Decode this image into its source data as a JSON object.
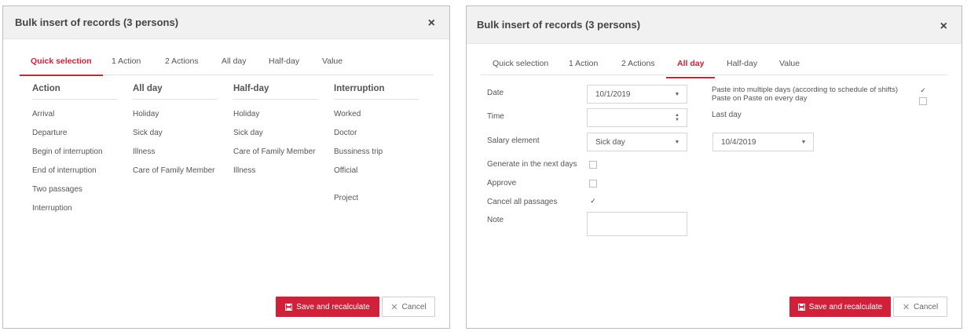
{
  "dialog1": {
    "title": "Bulk insert of records (3 persons)",
    "close": "×",
    "tabs": [
      "Quick selection",
      "1 Action",
      "2 Actions",
      "All day",
      "Half-day",
      "Value"
    ],
    "columns": [
      {
        "header": "Action",
        "items": [
          "Arrival",
          "Departure",
          "Begin of interruption",
          "End of interruption",
          "Two passages",
          "Interruption"
        ]
      },
      {
        "header": "All day",
        "items": [
          "Holiday",
          "Sick day",
          "Illness",
          "Care of Family Member"
        ]
      },
      {
        "header": "Half-day",
        "items": [
          "Holiday",
          "Sick day",
          "Care of Family Member",
          "Illness"
        ]
      },
      {
        "header": "Interruption",
        "items": [
          "Worked",
          "Doctor",
          "Bussiness trip",
          "Official",
          "Project"
        ]
      }
    ],
    "save_label": "Save and recalculate",
    "cancel_label": "Cancel"
  },
  "dialog2": {
    "title": "Bulk insert of records (3 persons)",
    "close": "×",
    "tabs": [
      "Quick selection",
      "1 Action",
      "2 Actions",
      "All day",
      "Half-day",
      "Value"
    ],
    "form": {
      "date_label": "Date",
      "date_value": "10/1/2019",
      "time_label": "Time",
      "time_value": "",
      "salary_label": "Salary element",
      "salary_value": "Sick day",
      "generate_label": "Generate in the next days",
      "approve_label": "Approve",
      "cancel_passages_label": "Cancel all passages",
      "note_label": "Note",
      "note_value": "",
      "paste_multiple_label": "Paste into multiple days (according to schedule of shifts)",
      "paste_every_label": "Paste on Paste on every day",
      "last_day_label": "Last day",
      "last_day_value": "10/4/2019"
    },
    "save_label": "Save and recalculate",
    "cancel_label": "Cancel"
  },
  "colors": {
    "accent": "#d0203a",
    "header_bg": "#f1f1f1",
    "border": "#bdbdbd"
  }
}
